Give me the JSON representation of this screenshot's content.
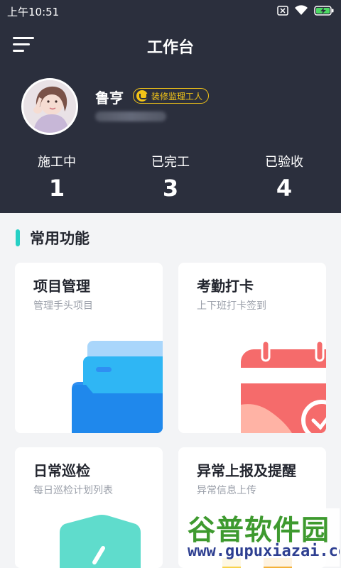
{
  "status_bar": {
    "time": "上午10:51"
  },
  "header": {
    "title": "工作台"
  },
  "user": {
    "name": "鲁亨",
    "role": "装修监理工人"
  },
  "stats": [
    {
      "label": "施工中",
      "value": "1"
    },
    {
      "label": "已完工",
      "value": "3"
    },
    {
      "label": "已验收",
      "value": "4"
    }
  ],
  "section": {
    "title": "常用功能"
  },
  "cards": [
    {
      "title": "项目管理",
      "subtitle": "管理手头项目"
    },
    {
      "title": "考勤打卡",
      "subtitle": "上下班打卡签到"
    },
    {
      "title": "日常巡检",
      "subtitle": "每日巡检计划列表"
    },
    {
      "title": "异常上报及提醒",
      "subtitle": "异常信息上传"
    }
  ],
  "watermark": {
    "title": "谷普软件园",
    "url": "www.gupuxiazai.com"
  },
  "colors": {
    "header_bg": "#2b2f3d",
    "accent_teal": "#26d0c5",
    "badge_yellow": "#f2c418",
    "calendar_red": "#f56b6b",
    "folder_blue": "#2f8ff2"
  }
}
